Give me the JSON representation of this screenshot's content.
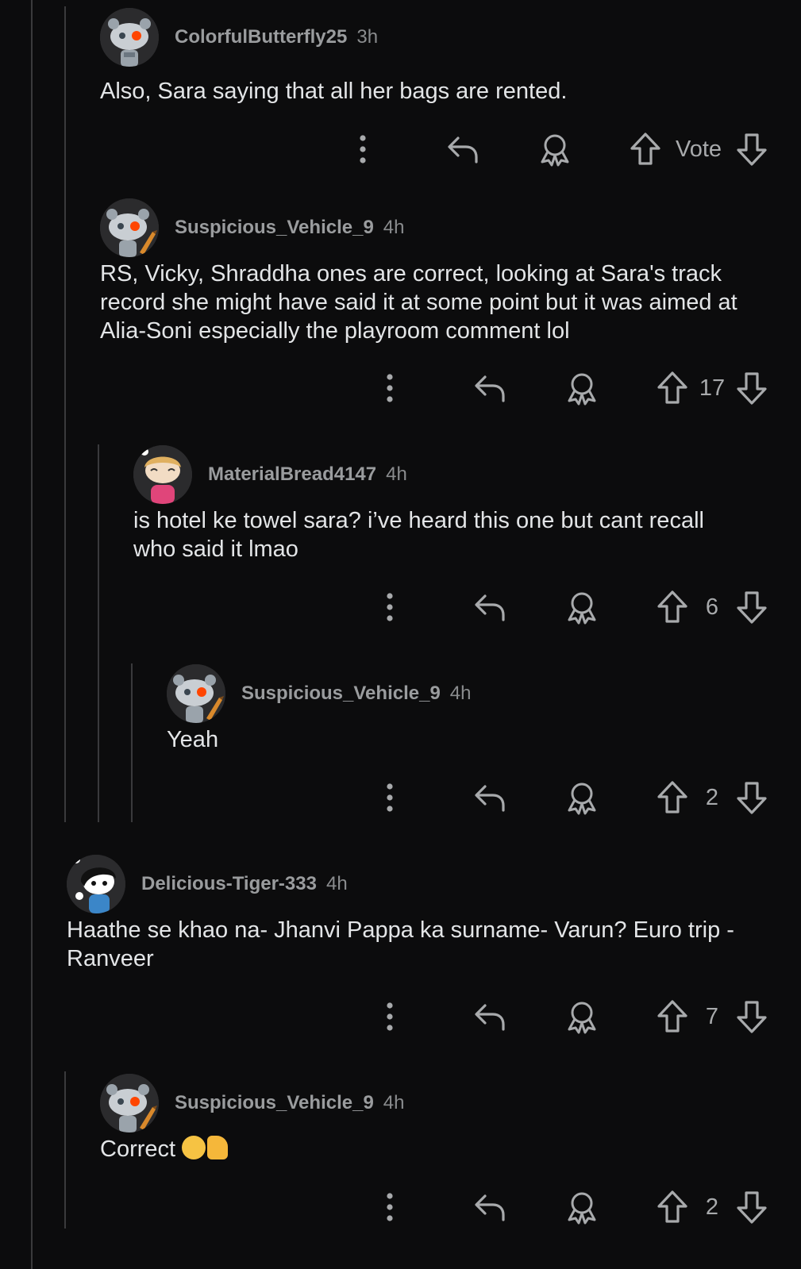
{
  "comments": [
    {
      "username": "ColorfulButterfly25",
      "time": "3h",
      "body": "Also, Sara saying that all her bags are rented.",
      "score": "Vote",
      "avatar": "robot-snoo"
    },
    {
      "username": "Suspicious_Vehicle_9",
      "time": "4h",
      "body": "RS, Vicky, Shraddha ones are correct, looking at Sara's track record she might have said it at some point but it was aimed at Alia-Soni especially the playroom comment lol",
      "score": "17",
      "avatar": "robot-snoo-pencil"
    },
    {
      "username": "MaterialBread4147",
      "time": "4h",
      "body": "is hotel ke towel sara? i’ve heard this one but cant recall who said it lmao",
      "score": "6",
      "avatar": "snoo-pink-hoodie"
    },
    {
      "username": "Suspicious_Vehicle_9",
      "time": "4h",
      "body": "Yeah",
      "score": "2",
      "avatar": "robot-snoo-pencil"
    },
    {
      "username": "Delicious-Tiger-333",
      "time": "4h",
      "body": "Haathe se khao na- Jhanvi Pappa ka surname- Varun? Euro trip - Ranveer",
      "score": "7",
      "avatar": "snoo-black-hair"
    },
    {
      "username": "Suspicious_Vehicle_9",
      "time": "4h",
      "body": "Correct",
      "emoji": [
        "grinning-sweat-emoji",
        "thumbs-up-emoji"
      ],
      "score": "2",
      "avatar": "robot-snoo-pencil"
    }
  ],
  "icons": {
    "more": "more-vertical-icon",
    "reply": "reply-icon",
    "award": "award-icon",
    "upvote": "upvote-icon",
    "downvote": "downvote-icon"
  },
  "colors": {
    "background": "#0c0c0d",
    "text": "#e3e5e7",
    "meta": "#9a9c9e",
    "thread_line": "#3a3a3c",
    "icon": "#a8aaac"
  }
}
